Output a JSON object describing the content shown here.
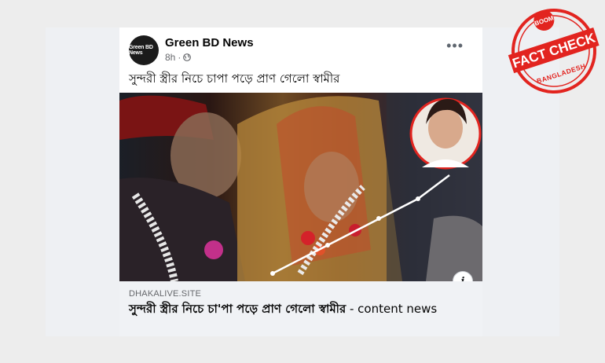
{
  "post": {
    "page_name": "Green BD News",
    "avatar_text": "Green BD News",
    "time": "8h",
    "dot": "·",
    "more": "•••",
    "caption": "সুন্দরী স্ত্রীর নিচে চাপা পড়ে প্রাণ গেলো স্বামীর"
  },
  "link": {
    "domain": "DHAKALIVE.SITE",
    "title_bold": "সুন্দরী স্ত্রীর নিচে চা'পা পড়ে প্রাণ গেলো স্বামীর",
    "title_rest": " - content news",
    "info": "i"
  },
  "stamp": {
    "top": "BOOM",
    "main": "FACT CHECK",
    "bottom": "BANGLADESH",
    "color": "#e2241f"
  }
}
